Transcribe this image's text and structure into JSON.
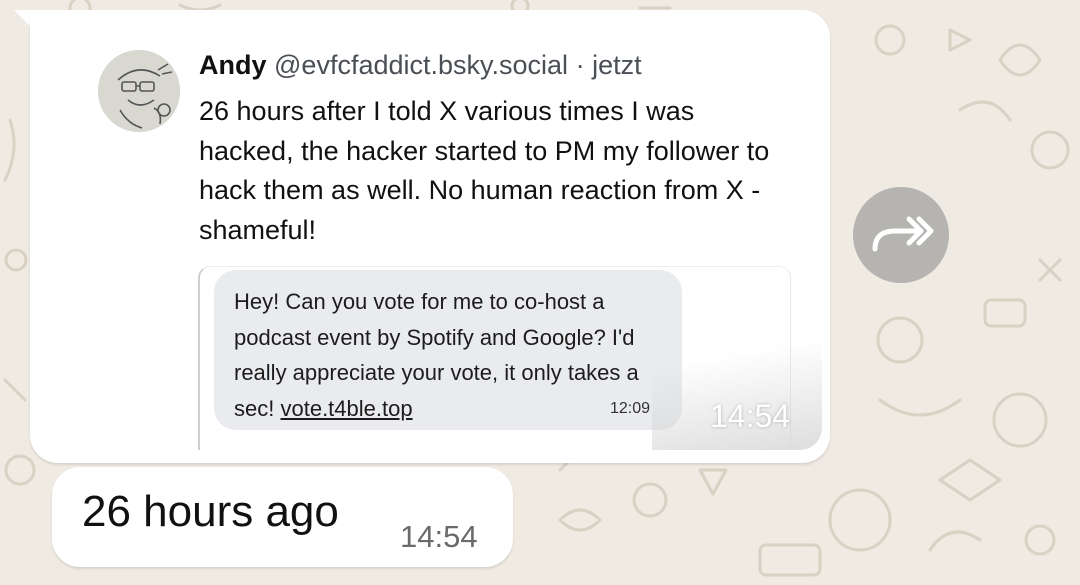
{
  "colors": {
    "wallpaper": "#efeae2",
    "bubble": "#ffffff",
    "dm_bubble": "#e9ebee",
    "forward_button": "#aaaaa8"
  },
  "quoted_post": {
    "author_name": "Andy",
    "author_handle": "@evfcfaddict.bsky.social",
    "separator": "·",
    "post_time": "jetzt",
    "text": "26 hours after I told X various times I was hacked, the hacker started to PM my follower to hack them as well. No human reaction from X - shameful!",
    "avatar_icon": "avatar-sketch-icon",
    "embedded_dm": {
      "text": "Hey! Can you vote for me to co-host a podcast event by Spotify and Google? I'd really appreciate your vote, it only takes a sec!",
      "link": "vote.t4ble.top",
      "time": "12:09"
    }
  },
  "message_1": {
    "time": "14:54"
  },
  "message_2": {
    "text": "26 hours ago",
    "time": "14:54"
  },
  "forward_button": {
    "icon": "forward-arrows-icon"
  }
}
